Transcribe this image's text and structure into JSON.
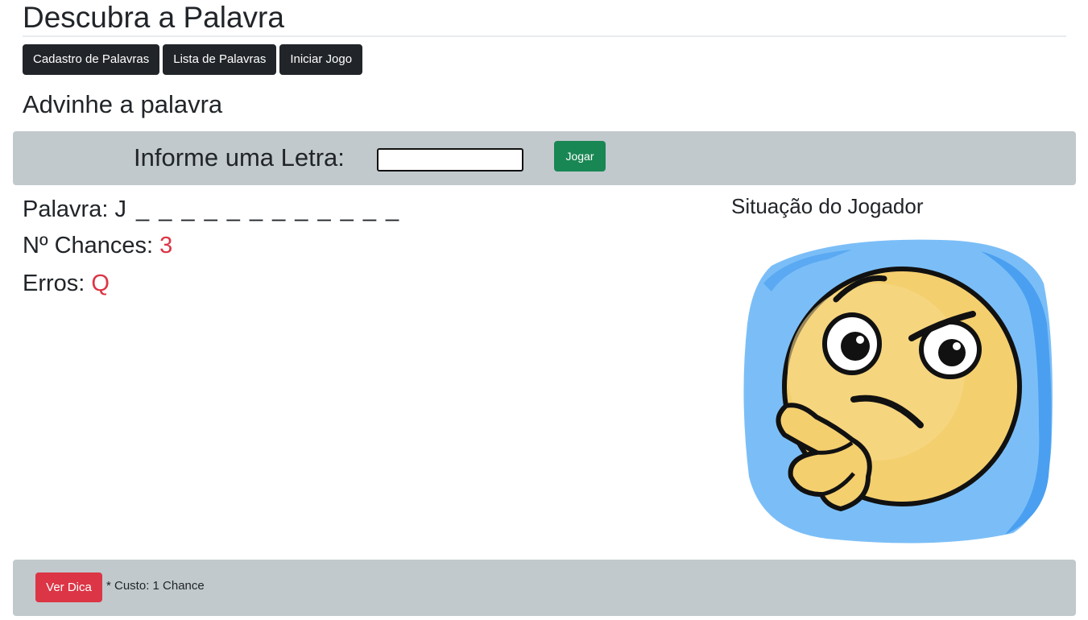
{
  "header": {
    "title": "Descubra a Palavra"
  },
  "nav": {
    "cadastro_label": "Cadastro de Palavras",
    "lista_label": "Lista de Palavras",
    "iniciar_label": "Iniciar Jogo"
  },
  "game": {
    "subtitle": "Advinhe a palavra",
    "letter_label": "Informe uma Letra:",
    "letter_value": "",
    "play_label": "Jogar",
    "word_label": "Palavra:",
    "word_value": "J _ _ _ _ _ _ _ _ _ _ _ _",
    "chances_label": "Nº Chances:",
    "chances_value": "3",
    "errors_label": "Erros:",
    "errors_value": "Q"
  },
  "player": {
    "title": "Situação do Jogador",
    "image_icon": "thinking-face-icon"
  },
  "hint": {
    "button_label": "Ver Dica",
    "cost_text": "* Custo: 1 Chance"
  },
  "colors": {
    "dark_button": "#212529",
    "play_button": "#198754",
    "hint_button": "#dc3545",
    "value_red": "#dc3545",
    "panel_gray": "#c1c9cd"
  }
}
